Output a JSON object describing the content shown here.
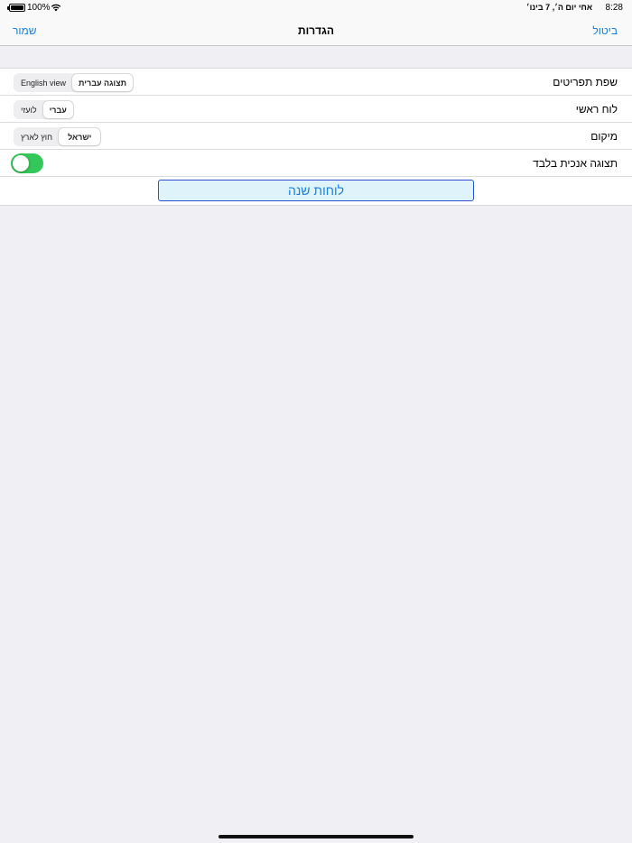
{
  "status_bar": {
    "time": "8:28",
    "date": "אחי יום ה׳, 7 בינו׳",
    "battery": "100%",
    "wifi_icon": "wifi-icon",
    "battery_icon": "battery-icon"
  },
  "nav": {
    "title": "הגדרות",
    "save_label": "שמור",
    "cancel_label": "ביטול",
    "accent": "#1a7ee0"
  },
  "settings": {
    "rows": [
      {
        "label": "שפת תפריטים",
        "options": [
          "תצוגה עברית",
          "English view"
        ],
        "selected": "תצוגה עברית"
      },
      {
        "label": "לוח ראשי",
        "options": [
          "עברי",
          "לועזי"
        ],
        "selected": "עברי"
      },
      {
        "label": "מיקום",
        "options": [
          "ישראל",
          "חוץ לארץ"
        ],
        "selected": "ישראל"
      }
    ],
    "toggle": {
      "label": "תצוגה אנכית בלבד",
      "on": true,
      "color": "#34c759"
    },
    "year_button": "לוחות שנה"
  }
}
